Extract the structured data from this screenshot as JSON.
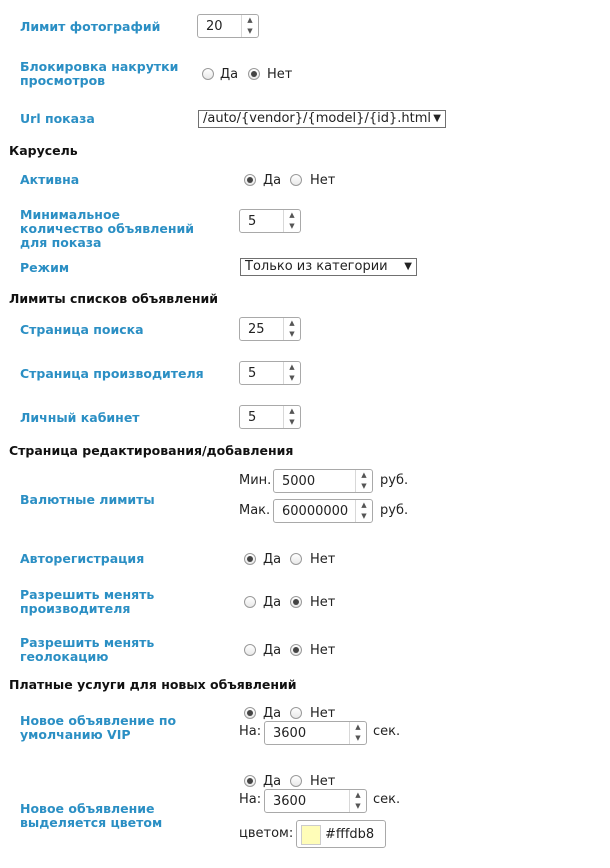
{
  "photo_limit": {
    "label": "Лимит фотографий",
    "value": "20"
  },
  "view_block": {
    "label": "Блокировка накрутки просмотров",
    "yes": "Да",
    "no": "Нет",
    "selected": "no"
  },
  "url_show": {
    "label": "Url показа",
    "value": "/auto/{vendor}/{model}/{id}.html"
  },
  "carousel": {
    "title": "Карусель",
    "active": {
      "label": "Активна",
      "yes": "Да",
      "no": "Нет",
      "selected": "yes"
    },
    "min_count": {
      "label": "Минимальное количество объявлений для показа",
      "value": "5"
    },
    "mode": {
      "label": "Режим",
      "value": "Только из категории"
    }
  },
  "list_limits": {
    "title": "Лимиты списков объявлений",
    "search": {
      "label": "Страница поиска",
      "value": "25"
    },
    "vendor": {
      "label": "Страница производителя",
      "value": "5"
    },
    "cabinet": {
      "label": "Личный кабинет",
      "value": "5"
    }
  },
  "edit_page": {
    "title": "Страница редактирования/добавления",
    "currency": {
      "label": "Валютные лимиты",
      "min_label": "Мин.",
      "min_value": "5000",
      "max_label": "Мак.",
      "max_value": "60000000",
      "unit": "руб."
    },
    "autoreg": {
      "label": "Авторегистрация",
      "yes": "Да",
      "no": "Нет",
      "selected": "yes"
    },
    "change_vendor": {
      "label": "Разрешить менять производителя",
      "yes": "Да",
      "no": "Нет",
      "selected": "no"
    },
    "change_geo": {
      "label": "Разрешить менять геолокацию",
      "yes": "Да",
      "no": "Нет",
      "selected": "no"
    }
  },
  "paid": {
    "title": "Платные услуги для новых объявлений",
    "vip": {
      "label": "Новое объявление по умолчанию VIP",
      "yes": "Да",
      "no": "Нет",
      "selected": "yes",
      "for_label": "На:",
      "value": "3600",
      "unit": "сек."
    },
    "color": {
      "label": "Новое объявление выделяется цветом",
      "yes": "Да",
      "no": "Нет",
      "selected": "yes",
      "for_label": "На:",
      "value": "3600",
      "unit": "сек.",
      "color_label": "цветом:",
      "color_value": "#fffdb8"
    }
  }
}
